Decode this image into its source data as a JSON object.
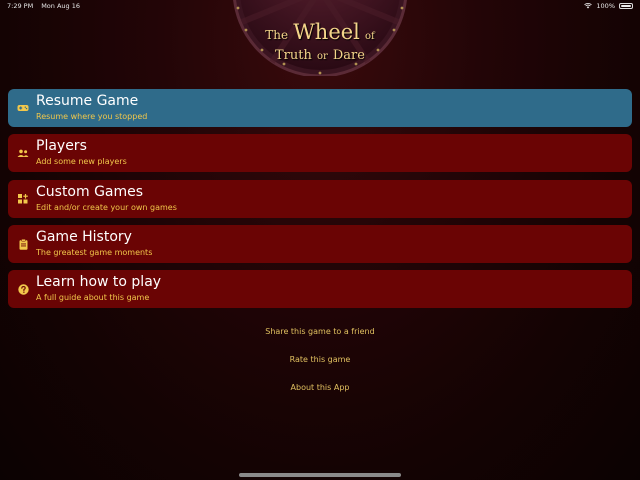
{
  "status": {
    "time": "7:29 PM",
    "date": "Mon Aug 16",
    "battery": "100%"
  },
  "logo": {
    "the": "The",
    "wheel": "Wheel",
    "of": "of",
    "truth": "Truth",
    "or": "or",
    "dare": "Dare"
  },
  "menu": [
    {
      "title": "Resume Game",
      "subtitle": "Resume where you stopped",
      "icon": "gamepad-icon",
      "active": true
    },
    {
      "title": "Players",
      "subtitle": "Add some new players",
      "icon": "players-icon",
      "active": false
    },
    {
      "title": "Custom Games",
      "subtitle": "Edit and/or create your own games",
      "icon": "custom-games-icon",
      "active": false
    },
    {
      "title": "Game History",
      "subtitle": "The greatest game moments",
      "icon": "clipboard-icon",
      "active": false
    },
    {
      "title": "Learn how to play",
      "subtitle": "A full guide about this game",
      "icon": "help-icon",
      "active": false
    }
  ],
  "links": {
    "share": "Share this game to a friend",
    "rate": "Rate this game",
    "about": "About this App"
  },
  "colors": {
    "active": "#2f6b8a",
    "item": "#6a0404",
    "accent": "#f2c84b",
    "logo_text": "#f4d58a"
  }
}
